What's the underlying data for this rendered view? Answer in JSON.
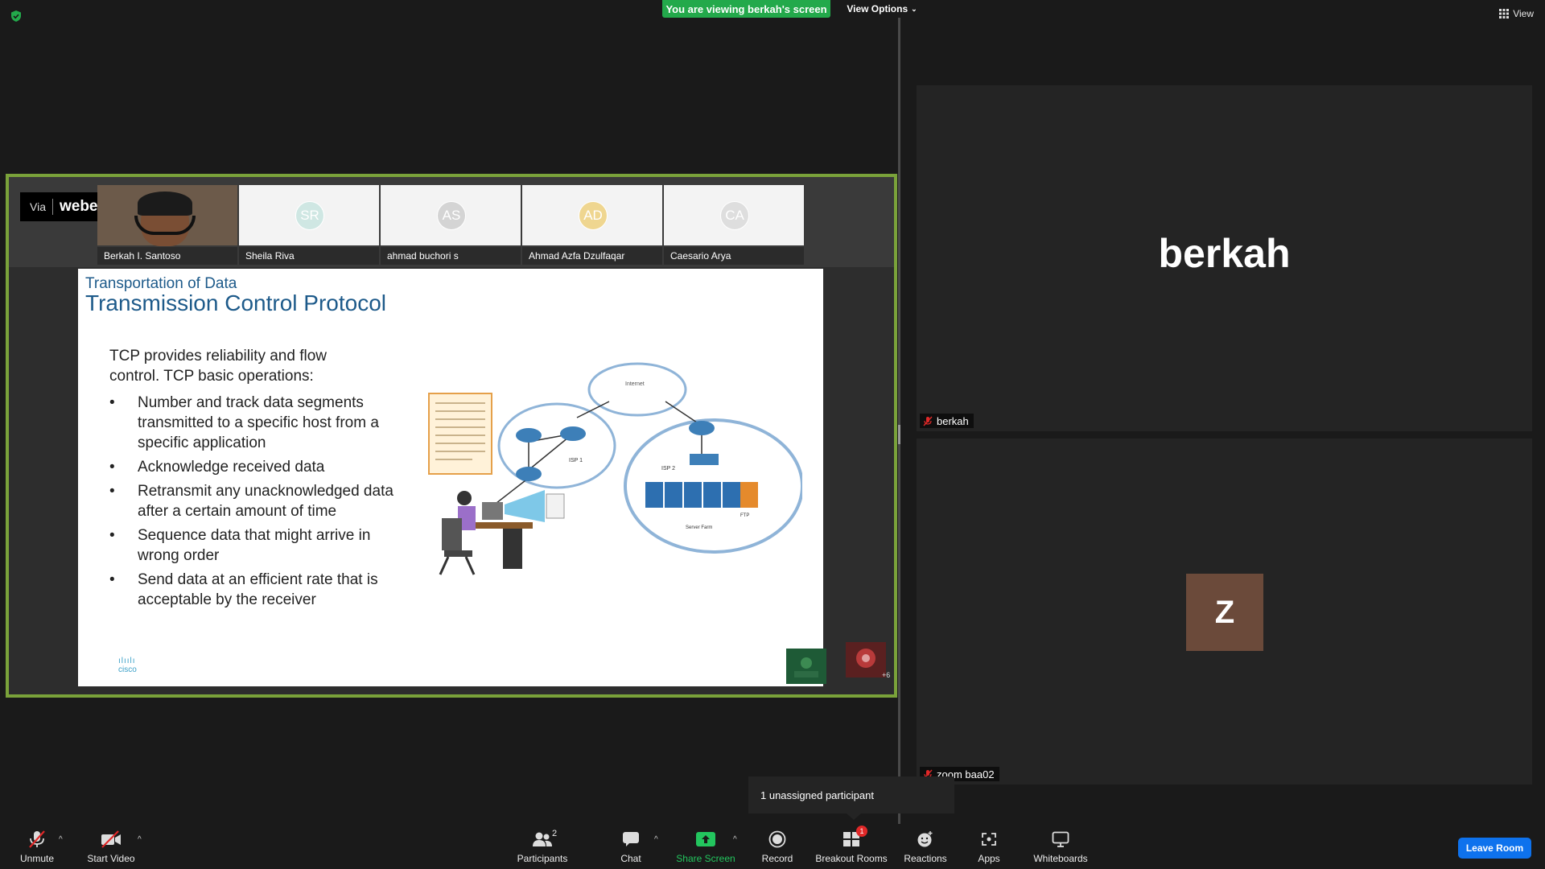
{
  "banner": {
    "viewing_text": "You are viewing berkah's screen",
    "view_options": "View Options"
  },
  "top_right": {
    "view_label": "View"
  },
  "webex": {
    "via": "Via",
    "brand": "webex",
    "tiles": [
      {
        "initials": "",
        "name": "Berkah I. Santoso"
      },
      {
        "initials": "SR",
        "name": "Sheila Riva",
        "color": "#cfe7e3"
      },
      {
        "initials": "AS",
        "name": "ahmad buchori s",
        "color": "#d9d9d9"
      },
      {
        "initials": "AD",
        "name": "Ahmad Azfa Dzulfaqar",
        "color": "#f0dca0"
      },
      {
        "initials": "CA",
        "name": "Caesario Arya",
        "color": "#e3e3e3"
      }
    ],
    "extra_count": "+6"
  },
  "slide": {
    "subtitle": "Transportation of Data",
    "title": "Transmission Control Protocol",
    "intro": "TCP provides reliability and flow control. TCP basic operations:",
    "bullets": [
      "Number and track data segments transmitted to a specific host from a specific application",
      "Acknowledge received data",
      "Retransmit any unacknowledged data after a certain amount of time",
      "Sequence data that might arrive in wrong order",
      "Send data at an efficient rate that is acceptable by the receiver"
    ],
    "diagram": {
      "isp1": "ISP 1",
      "isp2": "ISP 2",
      "ftp": "FTP",
      "server_farm": "Server Farm",
      "internet": "Internet"
    },
    "cisco": "cisco"
  },
  "panels": {
    "top": {
      "big_name": "berkah",
      "label": "berkah"
    },
    "bottom": {
      "avatar_letter": "Z",
      "label": "zoom baa02"
    }
  },
  "tooltip": {
    "text": "1 unassigned participant"
  },
  "toolbar": {
    "unmute": "Unmute",
    "start_video": "Start Video",
    "participants": "Participants",
    "participants_count": "2",
    "chat": "Chat",
    "share_screen": "Share Screen",
    "record": "Record",
    "breakout_rooms": "Breakout Rooms",
    "breakout_badge": "1",
    "reactions": "Reactions",
    "apps": "Apps",
    "whiteboards": "Whiteboards",
    "leave": "Leave Room"
  },
  "colors": {
    "share_border": "#7aa23a",
    "banner": "#23a94b",
    "leave": "#0e72ed",
    "mic_off": "#e02828"
  }
}
